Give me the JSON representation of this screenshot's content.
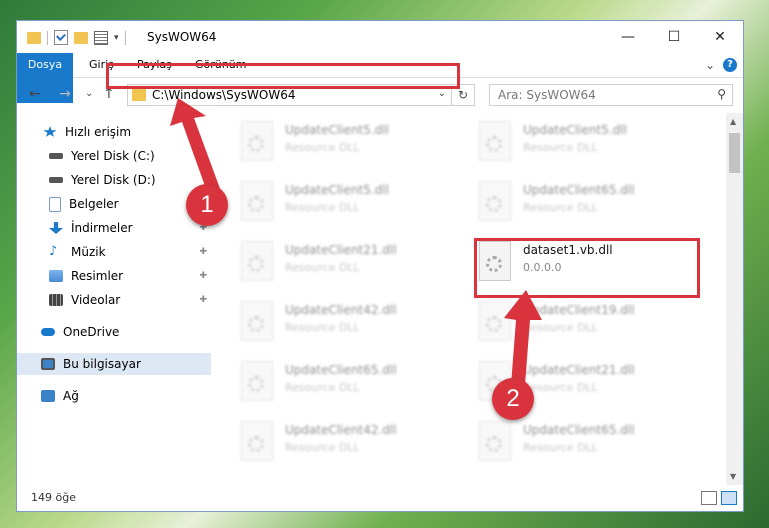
{
  "window": {
    "title": "SysWOW64"
  },
  "winbtns": {
    "minimize": "—",
    "maximize": "☐",
    "close": "✕"
  },
  "ribbon": {
    "tabs": [
      "Dosya",
      "Giriş",
      "Paylaş",
      "Görünüm"
    ],
    "expand": "⌄",
    "help": "?"
  },
  "nav": {
    "back": "←",
    "forward": "→",
    "recent": "⌄",
    "up": "↑"
  },
  "address": {
    "path": "C:\\Windows\\SysWOW64",
    "dropdown": "⌄",
    "refresh": "↻"
  },
  "search": {
    "placeholder": "Ara: SysWOW64",
    "icon": "⚲"
  },
  "sidebar": {
    "items": [
      {
        "label": "Hızlı erişim",
        "icon": "star-icon",
        "color": "#1979ca"
      },
      {
        "label": "Yerel Disk (C:)",
        "icon": "disk-icon",
        "color": "#555555",
        "pin": "📌"
      },
      {
        "label": "Yerel Disk (D:)",
        "icon": "disk-icon",
        "color": "#555555"
      },
      {
        "label": "Belgeler",
        "icon": "document-icon",
        "color": "#7a9cc6"
      },
      {
        "label": "İndirmeler",
        "icon": "download-icon",
        "color": "#1979ca",
        "pin": "📌"
      },
      {
        "label": "Müzik",
        "icon": "music-icon",
        "color": "#1979ca",
        "pin": "📌"
      },
      {
        "label": "Resimler",
        "icon": "pictures-icon",
        "color": "#4a8ad6",
        "pin": "📌"
      },
      {
        "label": "Videolar",
        "icon": "video-icon",
        "color": "#444444",
        "pin": "📌"
      },
      {
        "label": "OneDrive",
        "icon": "cloud-icon",
        "color": "#1979ca"
      },
      {
        "label": "Bu bilgisayar",
        "icon": "computer-icon",
        "color": "#3c82c8"
      },
      {
        "label": "Ağ",
        "icon": "network-icon",
        "color": "#3c82c8"
      }
    ]
  },
  "files": [
    {
      "name": "UpdateClient5.dll",
      "sub": "Resource DLL"
    },
    {
      "name": "UpdateClient5.dll",
      "sub": "Resource DLL"
    },
    {
      "name": "UpdateClient5.dll",
      "sub": "Resource DLL"
    },
    {
      "name": "UpdateClient65.dll",
      "sub": "Resource DLL"
    },
    {
      "name": "UpdateClient21.dll",
      "sub": "Resource DLL"
    },
    {
      "name": "dataset1.vb.dll",
      "sub": "0.0.0.0"
    },
    {
      "name": "UpdateClient42.dll",
      "sub": "Resource DLL"
    },
    {
      "name": "UpdateClient19.dll",
      "sub": "Resource DLL"
    },
    {
      "name": "UpdateClient65.dll",
      "sub": "Resource DLL"
    },
    {
      "name": "UpdateClient21.dll",
      "sub": "Resource DLL"
    },
    {
      "name": "UpdateClient42.dll",
      "sub": "Resource DLL"
    },
    {
      "name": "UpdateClient65.dll",
      "sub": "Resource DLL"
    }
  ],
  "status": {
    "count": "149 öğe"
  },
  "scroll": {
    "up": "▲",
    "down": "▼"
  },
  "badges": {
    "one": "1",
    "two": "2"
  },
  "colors": {
    "accent": "#1979ca",
    "highlight": "#d9343e"
  }
}
